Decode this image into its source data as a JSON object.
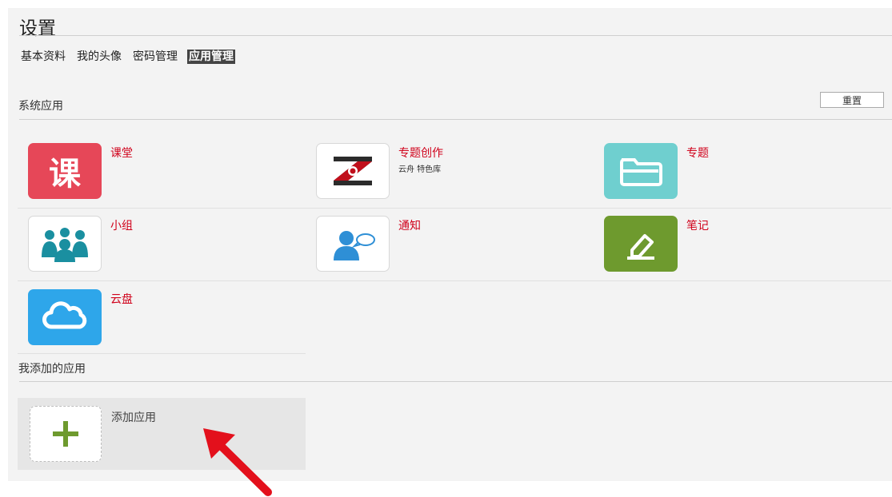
{
  "page": {
    "title": "设置"
  },
  "tabs": [
    {
      "label": "基本资料",
      "active": false
    },
    {
      "label": "我的头像",
      "active": false
    },
    {
      "label": "密码管理",
      "active": false
    },
    {
      "label": "应用管理",
      "active": true
    }
  ],
  "system_apps": {
    "label": "系统应用",
    "reset_label": "重置",
    "items": [
      {
        "name": "课堂",
        "icon": "ketang-icon",
        "color": "#e64758",
        "glyph": "课"
      },
      {
        "name": "专题创作",
        "subtitle": "云舟 特色库",
        "icon": "zhuanti-chuangzuo-icon",
        "color": "#ffffff"
      },
      {
        "name": "专题",
        "icon": "folder-icon",
        "color": "#6fcfcf"
      },
      {
        "name": "小组",
        "icon": "group-icon",
        "color": "#ffffff"
      },
      {
        "name": "通知",
        "icon": "notice-icon",
        "color": "#ffffff"
      },
      {
        "name": "笔记",
        "icon": "pen-icon",
        "color": "#6e9a2e"
      },
      {
        "name": "云盘",
        "icon": "cloud-icon",
        "color": "#2ea6ea"
      }
    ]
  },
  "my_apps": {
    "label": "我添加的应用",
    "add_label": "添加应用"
  }
}
